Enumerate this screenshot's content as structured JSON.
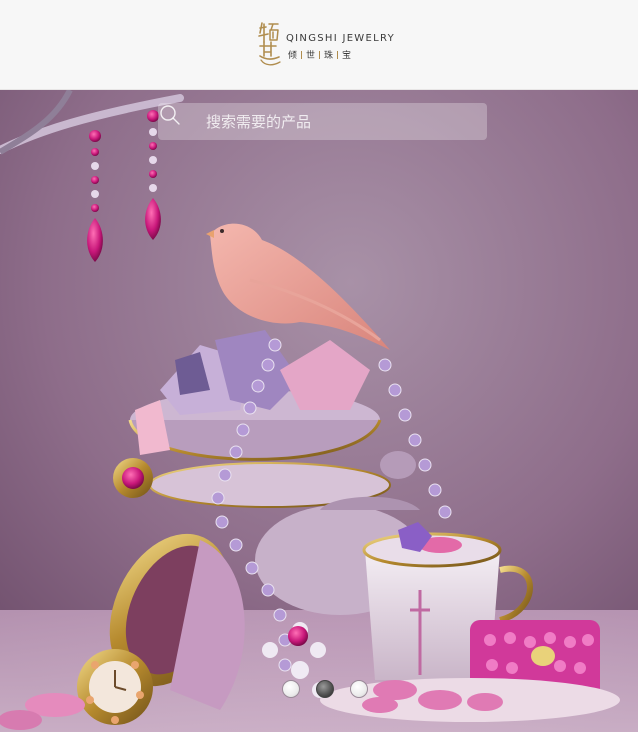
{
  "header": {
    "logo": {
      "mark_text": "倾世",
      "latin_text": "QINGSHI JEWELRY",
      "cn_chars": [
        "倾",
        "世",
        "珠",
        "宝"
      ]
    }
  },
  "search": {
    "placeholder": "搜索需要的产品",
    "value": "",
    "icon": "search-icon"
  },
  "carousel": {
    "image_label": "",
    "slide_count": 3,
    "active_index": 1
  },
  "colors": {
    "accent_gold": "#b08d4e",
    "hero_mauve": "#8f6f8c"
  }
}
